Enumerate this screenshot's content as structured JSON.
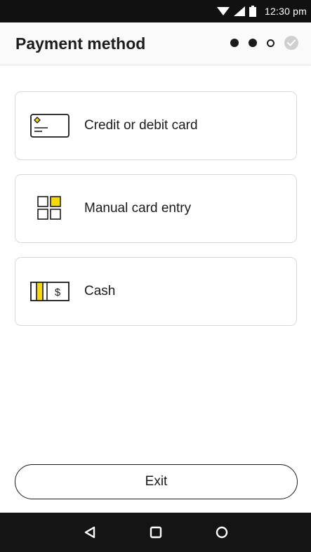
{
  "status_bar": {
    "time": "12:30 pm",
    "icons": [
      "wifi-icon",
      "signal-icon",
      "battery-icon"
    ]
  },
  "header": {
    "title": "Payment method",
    "steps": [
      "completed",
      "completed",
      "current",
      "done-check"
    ]
  },
  "options": [
    {
      "label": "Credit or debit card",
      "icon": "card-icon"
    },
    {
      "label": "Manual card entry",
      "icon": "manual-entry-icon"
    },
    {
      "label": "Cash",
      "icon": "cash-icon",
      "icon_symbol": "$"
    }
  ],
  "exit": {
    "label": "Exit"
  },
  "nav_bar": {
    "buttons": [
      "back-icon",
      "home-icon",
      "recents-icon"
    ]
  },
  "colors": {
    "accent": "#f5d90a",
    "text": "#1a1a1a",
    "status_bar_bg": "#111111",
    "nav_bar_bg": "#141414",
    "card_border": "#d8d8d8"
  }
}
